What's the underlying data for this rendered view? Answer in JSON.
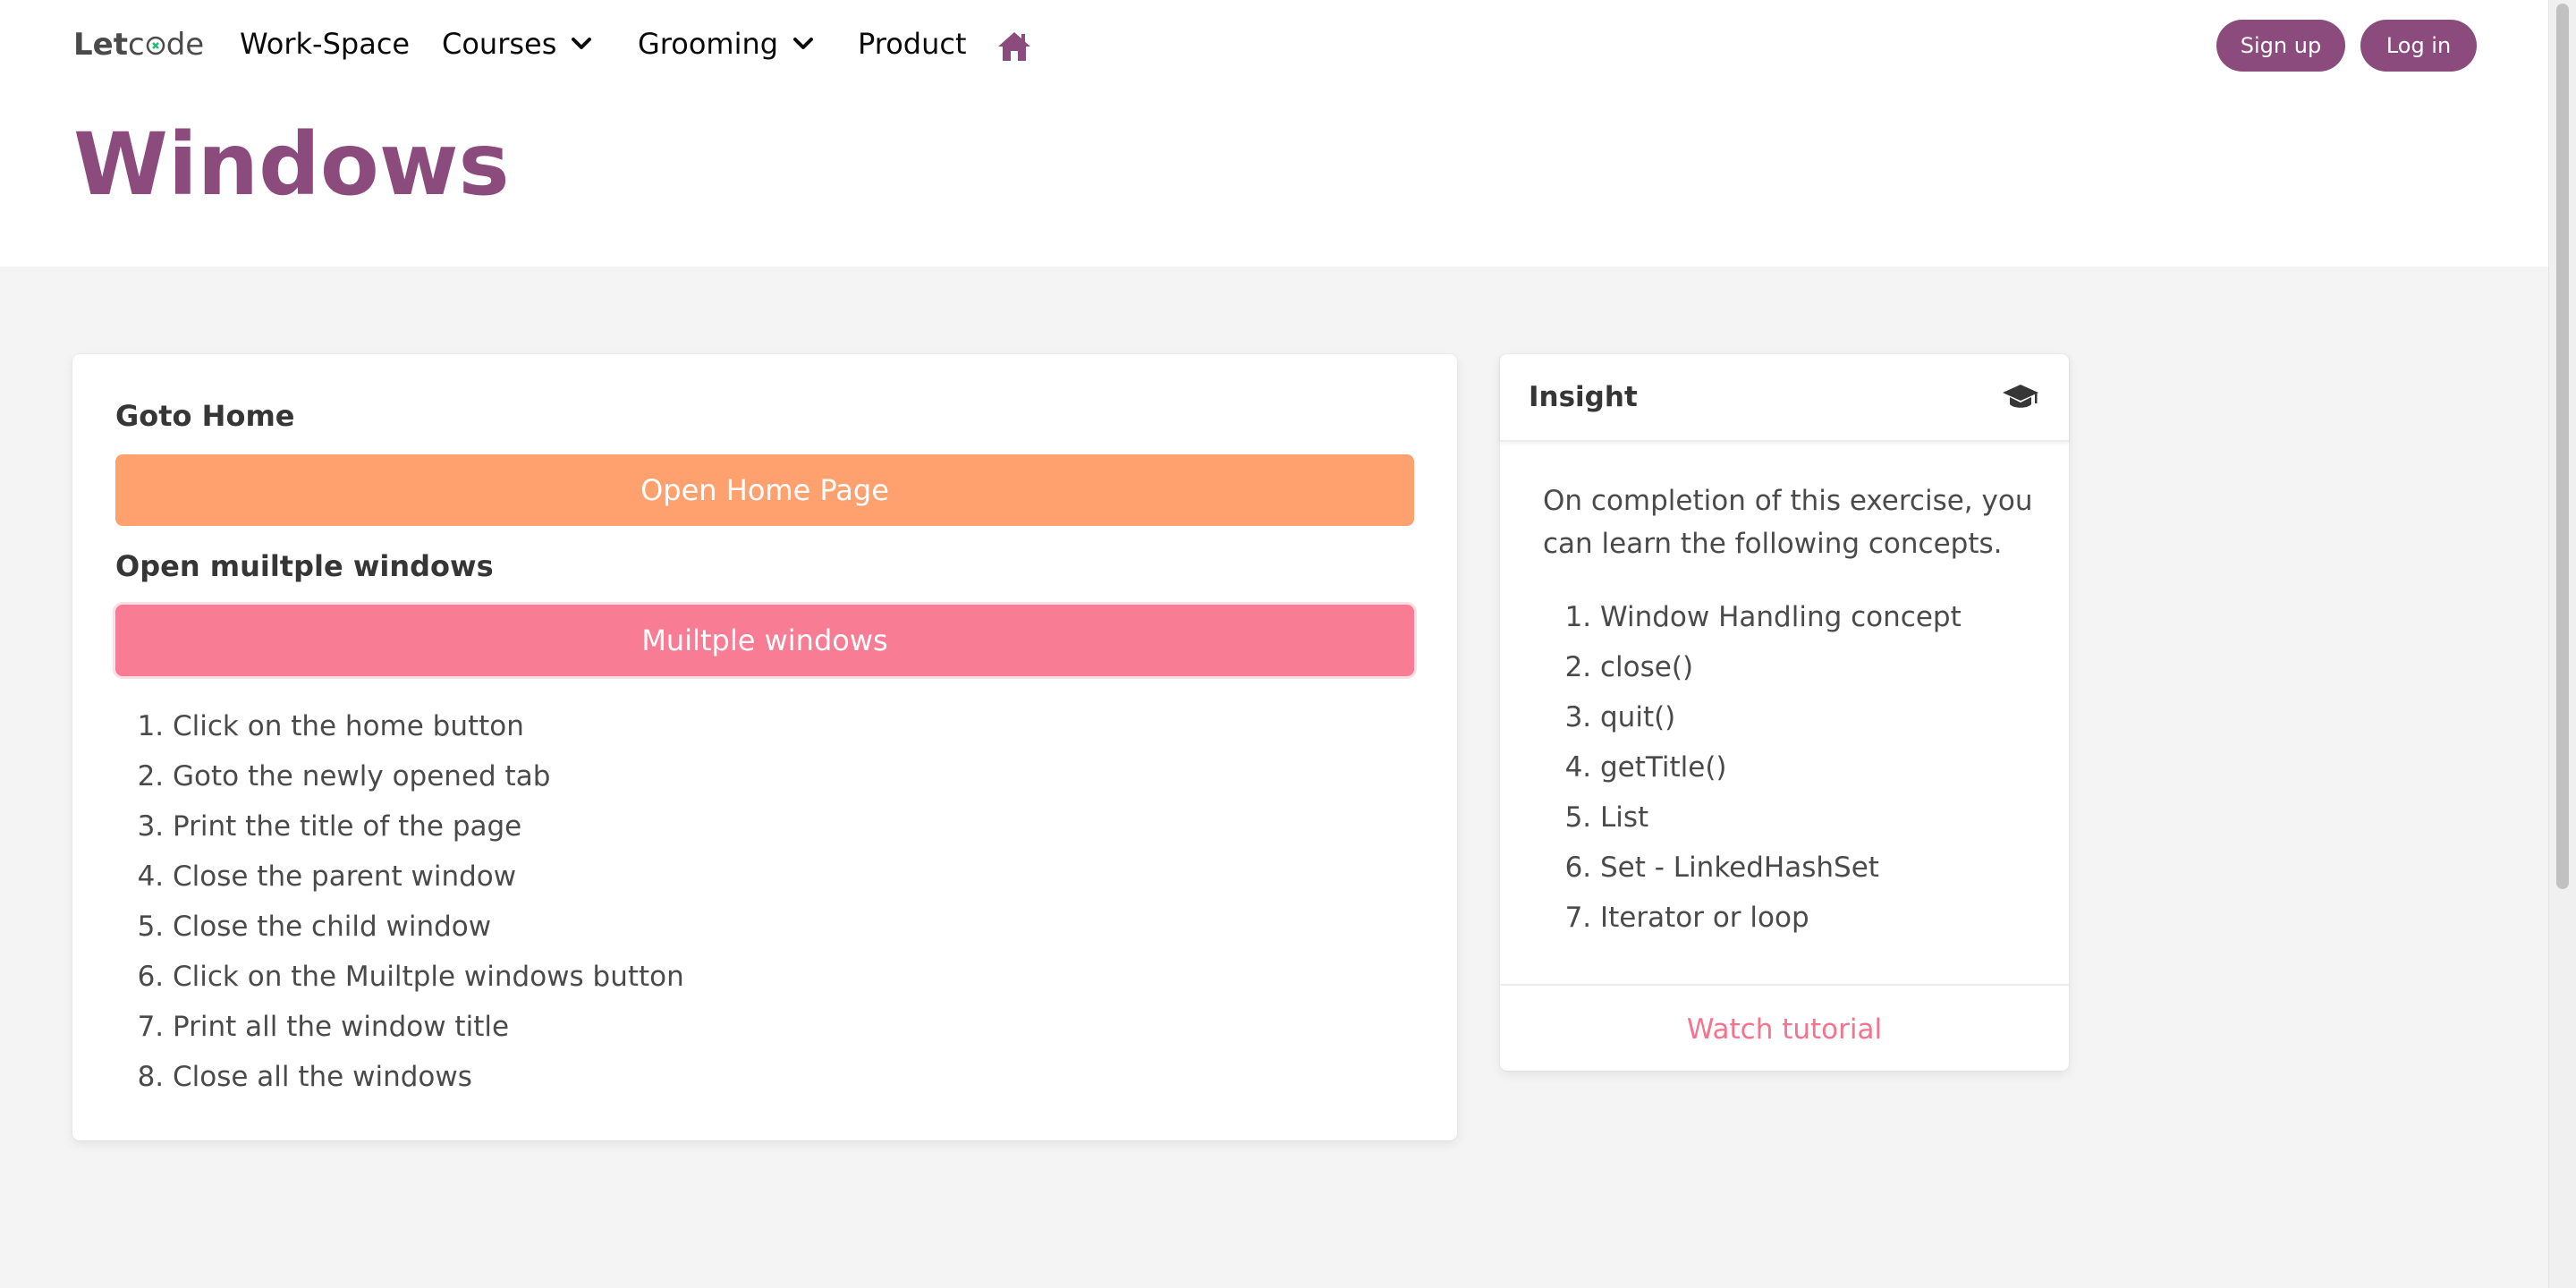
{
  "nav": {
    "logo_let": "Let",
    "logo_c": "c",
    "logo_de": "de",
    "items": [
      {
        "label": "Work-Space"
      },
      {
        "label": "Courses"
      },
      {
        "label": "Grooming"
      },
      {
        "label": "Product"
      }
    ],
    "signup_label": "Sign up",
    "login_label": "Log in"
  },
  "page": {
    "title": "Windows"
  },
  "main_card": {
    "goto_home_label": "Goto Home",
    "open_home_button": "Open Home Page",
    "multi_label": "Open muiltple windows",
    "multi_button": "Muiltple windows",
    "steps": [
      "Click on the home button",
      "Goto the newly opened tab",
      "Print the title of the page",
      "Close the parent window",
      "Close the child window",
      "Click on the Muiltple windows button",
      "Print all the window title",
      "Close all the windows"
    ]
  },
  "insight": {
    "title": "Insight",
    "intro": "On completion of this exercise, you can learn the following concepts.",
    "concepts": [
      "Window Handling concept",
      "close()",
      "quit()",
      "getTitle()",
      "List",
      "Set - LinkedHashSet",
      "Iterator or loop"
    ],
    "watch_label": "Watch tutorial"
  },
  "colors": {
    "brand": "#8b4b7d",
    "orange_button": "#ffa16e",
    "pink_button": "#f87c93",
    "link_pink": "#f4748f",
    "logo_accent": "#1fbe73"
  }
}
